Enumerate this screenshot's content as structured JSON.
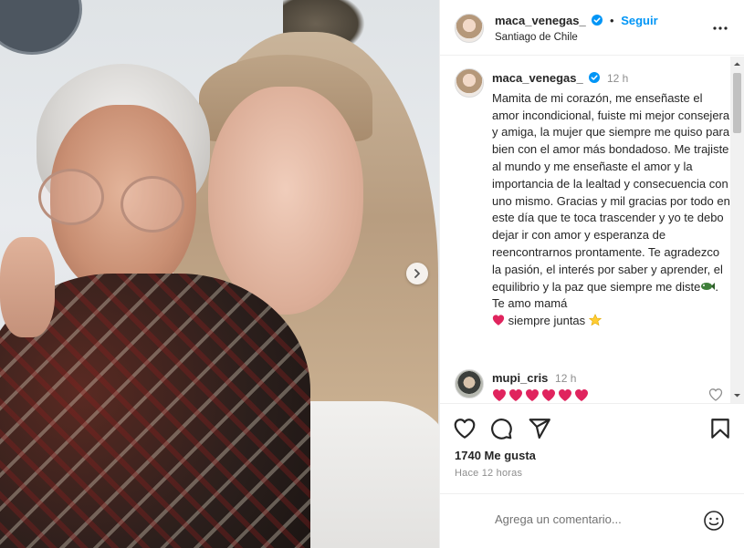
{
  "post": {
    "username": "maca_venegas_",
    "follow_label": "Seguir",
    "location": "Santiago de Chile"
  },
  "caption": {
    "username": "maca_venegas_",
    "time": "12 h",
    "text_main": "Mamita de mi corazón, me enseñaste el amor incondicional, fuiste mi mejor consejera y amiga, la mujer que siempre me quiso para bien con el amor más bondadoso. Me trajiste al mundo y me enseñaste el amor y la importancia de la lealtad y consecuencia con uno mismo. Gracias y mil gracias por todo en este día que te toca trascender y yo te debo dejar ir con amor y esperanza de reencontrarnos prontamente. Te agradezco la pasión, el interés por saber y aprender, el equilibrio y la paz que siempre me diste",
    "text_after_fish": ". Te amo mamá",
    "text_end": "siempre juntas"
  },
  "comments": [
    {
      "username": "mupi_cris",
      "time": "12 h",
      "hearts": 6
    }
  ],
  "stats": {
    "likes": "1740 Me gusta",
    "when": "Hace 12 horas"
  },
  "comment_box": {
    "placeholder": "Agrega un comentario..."
  },
  "colors": {
    "accent": "#0095f6",
    "heart": "#ed4956",
    "muted": "#8e8e8e"
  },
  "icons": [
    "verified-icon",
    "more-options-icon",
    "next-photo-icon",
    "like-icon",
    "comment-icon",
    "share-icon",
    "save-icon",
    "emoji-icon"
  ]
}
